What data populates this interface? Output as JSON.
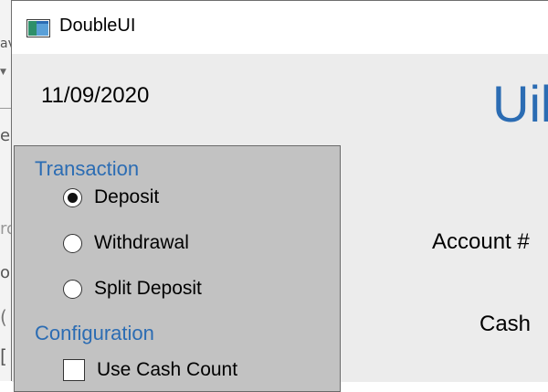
{
  "window": {
    "title": "DoubleUI"
  },
  "header": {
    "date": "11/09/2020",
    "brand_fragment": "Uil"
  },
  "transaction": {
    "title": "Transaction",
    "options": [
      {
        "label": "Deposit",
        "selected": true
      },
      {
        "label": "Withdrawal",
        "selected": false
      },
      {
        "label": "Split Deposit",
        "selected": false
      }
    ]
  },
  "configuration": {
    "title": "Configuration",
    "use_cash_count": {
      "label": "Use Cash Count",
      "checked": false
    }
  },
  "fields": {
    "account_label": "Account #",
    "cash_label": "Cash"
  },
  "background_app": {
    "fragments": [
      "av",
      "e",
      "ro",
      "o",
      "(",
      "["
    ]
  },
  "colors": {
    "accent": "#2b6cb3",
    "panel": "#c2c2c2",
    "window_bg": "#ececec"
  }
}
